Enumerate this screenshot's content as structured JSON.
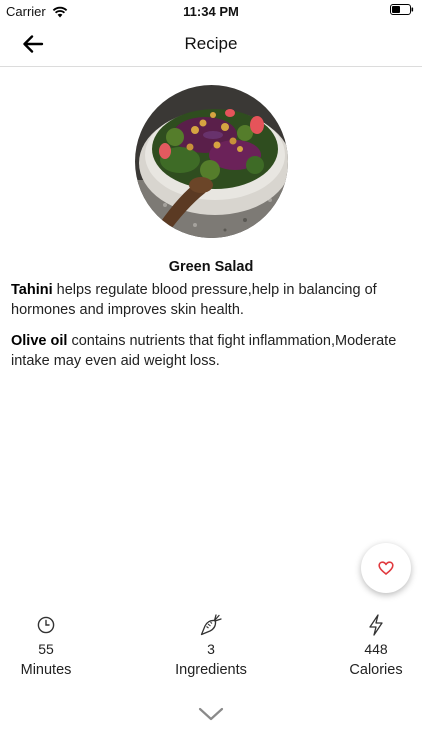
{
  "status_bar": {
    "carrier": "Carrier",
    "time": "11:34 PM"
  },
  "nav": {
    "title": "Recipe"
  },
  "recipe": {
    "name": "Green Salad",
    "image_icon": "salad-bowl-image"
  },
  "descriptions": [
    {
      "ingredient": "Tahini",
      "text": " helps regulate blood pressure,help in  balancing of hormones and improves skin health."
    },
    {
      "ingredient": "Olive oil",
      "text": " contains nutrients that fight inflammation,Moderate intake may even aid weight loss."
    }
  ],
  "stats": [
    {
      "icon": "clock-icon",
      "value": "55",
      "label": "Minutes"
    },
    {
      "icon": "carrot-icon",
      "value": "3",
      "label": "Ingredients"
    },
    {
      "icon": "lightning-icon",
      "value": "448",
      "label": "Calories"
    }
  ],
  "colors": {
    "accent": "#e0393e",
    "divider": "#dcdcdc",
    "text": "#222222"
  }
}
